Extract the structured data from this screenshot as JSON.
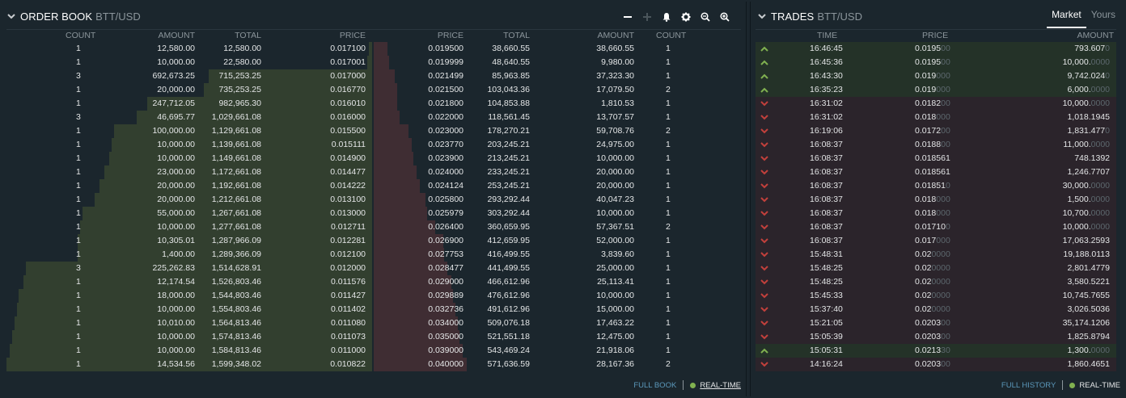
{
  "orderbook": {
    "title": "ORDER BOOK",
    "pair": "BTT/USD",
    "toolbar": [
      "minus-icon",
      "plus-icon",
      "bell-icon",
      "gear-icon",
      "zoom-out-icon",
      "zoom-in-icon"
    ],
    "bid_headers": {
      "count": "COUNT",
      "amount": "AMOUNT",
      "total": "TOTAL",
      "price": "PRICE"
    },
    "ask_headers": {
      "price": "PRICE",
      "total": "TOTAL",
      "amount": "AMOUNT",
      "count": "COUNT"
    },
    "max_total": 1599348.02,
    "ask_max_total": 571636.59,
    "bids": [
      {
        "count": "1",
        "amount": "12,580.00",
        "total": "12,580.00",
        "price": "0.017100",
        "total_value": 12580.0
      },
      {
        "count": "1",
        "amount": "10,000.00",
        "total": "22,580.00",
        "price": "0.017001",
        "total_value": 22580.0
      },
      {
        "count": "3",
        "amount": "692,673.25",
        "total": "715,253.25",
        "price": "0.017000",
        "total_value": 715253.25
      },
      {
        "count": "1",
        "amount": "20,000.00",
        "total": "735,253.25",
        "price": "0.016770",
        "total_value": 735253.25
      },
      {
        "count": "1",
        "amount": "247,712.05",
        "total": "982,965.30",
        "price": "0.016010",
        "total_value": 982965.3
      },
      {
        "count": "3",
        "amount": "46,695.77",
        "total": "1,029,661.08",
        "price": "0.016000",
        "total_value": 1029661.08
      },
      {
        "count": "1",
        "amount": "100,000.00",
        "total": "1,129,661.08",
        "price": "0.015500",
        "total_value": 1129661.08
      },
      {
        "count": "1",
        "amount": "10,000.00",
        "total": "1,139,661.08",
        "price": "0.015111",
        "total_value": 1139661.08
      },
      {
        "count": "1",
        "amount": "10,000.00",
        "total": "1,149,661.08",
        "price": "0.014900",
        "total_value": 1149661.08
      },
      {
        "count": "1",
        "amount": "23,000.00",
        "total": "1,172,661.08",
        "price": "0.014477",
        "total_value": 1172661.08
      },
      {
        "count": "1",
        "amount": "20,000.00",
        "total": "1,192,661.08",
        "price": "0.014222",
        "total_value": 1192661.08
      },
      {
        "count": "1",
        "amount": "20,000.00",
        "total": "1,212,661.08",
        "price": "0.013100",
        "total_value": 1212661.08
      },
      {
        "count": "1",
        "amount": "55,000.00",
        "total": "1,267,661.08",
        "price": "0.013000",
        "total_value": 1267661.08
      },
      {
        "count": "1",
        "amount": "10,000.00",
        "total": "1,277,661.08",
        "price": "0.012711",
        "total_value": 1277661.08
      },
      {
        "count": "1",
        "amount": "10,305.01",
        "total": "1,287,966.09",
        "price": "0.012281",
        "total_value": 1287966.09
      },
      {
        "count": "1",
        "amount": "1,400.00",
        "total": "1,289,366.09",
        "price": "0.012100",
        "total_value": 1289366.09
      },
      {
        "count": "3",
        "amount": "225,262.83",
        "total": "1,514,628.91",
        "price": "0.012000",
        "total_value": 1514628.91
      },
      {
        "count": "1",
        "amount": "12,174.54",
        "total": "1,526,803.46",
        "price": "0.011576",
        "total_value": 1526803.46
      },
      {
        "count": "1",
        "amount": "18,000.00",
        "total": "1,544,803.46",
        "price": "0.011427",
        "total_value": 1544803.46
      },
      {
        "count": "1",
        "amount": "10,000.00",
        "total": "1,554,803.46",
        "price": "0.011402",
        "total_value": 1554803.46
      },
      {
        "count": "1",
        "amount": "10,010.00",
        "total": "1,564,813.46",
        "price": "0.011080",
        "total_value": 1564813.46
      },
      {
        "count": "1",
        "amount": "10,000.00",
        "total": "1,574,813.46",
        "price": "0.011073",
        "total_value": 1574813.46
      },
      {
        "count": "1",
        "amount": "10,000.00",
        "total": "1,584,813.46",
        "price": "0.011000",
        "total_value": 1584813.46
      },
      {
        "count": "1",
        "amount": "14,534.56",
        "total": "1,599,348.02",
        "price": "0.010822",
        "total_value": 1599348.02
      }
    ],
    "asks": [
      {
        "price": "0.019500",
        "total": "38,660.55",
        "amount": "38,660.55",
        "count": "1",
        "total_value": 38660.55
      },
      {
        "price": "0.019999",
        "total": "48,640.55",
        "amount": "9,980.00",
        "count": "1",
        "total_value": 48640.55
      },
      {
        "price": "0.021499",
        "total": "85,963.85",
        "amount": "37,323.30",
        "count": "1",
        "total_value": 85963.85
      },
      {
        "price": "0.021500",
        "total": "103,043.36",
        "amount": "17,079.50",
        "count": "2",
        "total_value": 103043.36
      },
      {
        "price": "0.021800",
        "total": "104,853.88",
        "amount": "1,810.53",
        "count": "1",
        "total_value": 104853.88
      },
      {
        "price": "0.022000",
        "total": "118,561.45",
        "amount": "13,707.57",
        "count": "1",
        "total_value": 118561.45
      },
      {
        "price": "0.023000",
        "total": "178,270.21",
        "amount": "59,708.76",
        "count": "2",
        "total_value": 178270.21
      },
      {
        "price": "0.023770",
        "total": "203,245.21",
        "amount": "24,975.00",
        "count": "1",
        "total_value": 203245.21
      },
      {
        "price": "0.023900",
        "total": "213,245.21",
        "amount": "10,000.00",
        "count": "1",
        "total_value": 213245.21
      },
      {
        "price": "0.024000",
        "total": "233,245.21",
        "amount": "20,000.00",
        "count": "1",
        "total_value": 233245.21
      },
      {
        "price": "0.024124",
        "total": "253,245.21",
        "amount": "20,000.00",
        "count": "1",
        "total_value": 253245.21
      },
      {
        "price": "0.025800",
        "total": "293,292.44",
        "amount": "40,047.23",
        "count": "1",
        "total_value": 293292.44
      },
      {
        "price": "0.025979",
        "total": "303,292.44",
        "amount": "10,000.00",
        "count": "1",
        "total_value": 303292.44
      },
      {
        "price": "0.026400",
        "total": "360,659.95",
        "amount": "57,367.51",
        "count": "2",
        "total_value": 360659.95
      },
      {
        "price": "0.026900",
        "total": "412,659.95",
        "amount": "52,000.00",
        "count": "1",
        "total_value": 412659.95
      },
      {
        "price": "0.027753",
        "total": "416,499.55",
        "amount": "3,839.60",
        "count": "1",
        "total_value": 416499.55
      },
      {
        "price": "0.028477",
        "total": "441,499.55",
        "amount": "25,000.00",
        "count": "1",
        "total_value": 441499.55
      },
      {
        "price": "0.029000",
        "total": "466,612.96",
        "amount": "25,113.41",
        "count": "1",
        "total_value": 466612.96
      },
      {
        "price": "0.029889",
        "total": "476,612.96",
        "amount": "10,000.00",
        "count": "1",
        "total_value": 476612.96
      },
      {
        "price": "0.032736",
        "total": "491,612.96",
        "amount": "15,000.00",
        "count": "1",
        "total_value": 491612.96
      },
      {
        "price": "0.034000",
        "total": "509,076.18",
        "amount": "17,463.22",
        "count": "1",
        "total_value": 509076.18
      },
      {
        "price": "0.035000",
        "total": "521,551.18",
        "amount": "12,475.00",
        "count": "1",
        "total_value": 521551.18
      },
      {
        "price": "0.039000",
        "total": "543,469.24",
        "amount": "21,918.06",
        "count": "1",
        "total_value": 543469.24
      },
      {
        "price": "0.040000",
        "total": "571,636.59",
        "amount": "28,167.36",
        "count": "2",
        "total_value": 571636.59
      }
    ],
    "footer": {
      "full_book": "FULL BOOK",
      "realtime": "REAL-TIME"
    }
  },
  "trades": {
    "title": "TRADES",
    "pair": "BTT/USD",
    "tabs": [
      {
        "label": "Market",
        "active": true
      },
      {
        "label": "Yours",
        "active": false
      }
    ],
    "headers": {
      "time": "TIME",
      "price": "PRICE",
      "amount": "AMOUNT"
    },
    "rows": [
      {
        "side": "buy",
        "time": "16:46:45",
        "price": "0.0195",
        "price_dim": "00",
        "amount": "793.607",
        "amount_dim": "0"
      },
      {
        "side": "buy",
        "time": "16:45:36",
        "price": "0.0195",
        "price_dim": "00",
        "amount": "10,000.",
        "amount_dim": "0000"
      },
      {
        "side": "buy",
        "time": "16:43:30",
        "price": "0.019",
        "price_dim": "000",
        "amount": "9,742.024",
        "amount_dim": "0"
      },
      {
        "side": "buy",
        "time": "16:35:23",
        "price": "0.019",
        "price_dim": "000",
        "amount": "6,000.",
        "amount_dim": "0000"
      },
      {
        "side": "sell",
        "time": "16:31:02",
        "price": "0.0182",
        "price_dim": "00",
        "amount": "10,000.",
        "amount_dim": "0000"
      },
      {
        "side": "sell",
        "time": "16:31:02",
        "price": "0.018",
        "price_dim": "000",
        "amount": "1,018.1945",
        "amount_dim": ""
      },
      {
        "side": "sell",
        "time": "16:19:06",
        "price": "0.0172",
        "price_dim": "00",
        "amount": "1,831.477",
        "amount_dim": "0"
      },
      {
        "side": "sell",
        "time": "16:08:37",
        "price": "0.0188",
        "price_dim": "00",
        "amount": "11,000.",
        "amount_dim": "0000"
      },
      {
        "side": "sell",
        "time": "16:08:37",
        "price": "0.018561",
        "price_dim": "",
        "amount": "748.1392",
        "amount_dim": ""
      },
      {
        "side": "sell",
        "time": "16:08:37",
        "price": "0.018561",
        "price_dim": "",
        "amount": "1,246.7707",
        "amount_dim": ""
      },
      {
        "side": "sell",
        "time": "16:08:37",
        "price": "0.01851",
        "price_dim": "0",
        "amount": "30,000.",
        "amount_dim": "0000"
      },
      {
        "side": "sell",
        "time": "16:08:37",
        "price": "0.018",
        "price_dim": "000",
        "amount": "1,500.",
        "amount_dim": "0000"
      },
      {
        "side": "sell",
        "time": "16:08:37",
        "price": "0.018",
        "price_dim": "000",
        "amount": "10,700.",
        "amount_dim": "0000"
      },
      {
        "side": "sell",
        "time": "16:08:37",
        "price": "0.01710",
        "price_dim": "0",
        "amount": "10,000.",
        "amount_dim": "0000"
      },
      {
        "side": "sell",
        "time": "16:08:37",
        "price": "0.017",
        "price_dim": "000",
        "amount": "17,063.2593",
        "amount_dim": ""
      },
      {
        "side": "sell",
        "time": "15:48:31",
        "price": "0.02",
        "price_dim": "0000",
        "amount": "19,188.0113",
        "amount_dim": ""
      },
      {
        "side": "sell",
        "time": "15:48:25",
        "price": "0.02",
        "price_dim": "0000",
        "amount": "2,801.4779",
        "amount_dim": ""
      },
      {
        "side": "sell",
        "time": "15:48:25",
        "price": "0.02",
        "price_dim": "0000",
        "amount": "3,580.5221",
        "amount_dim": ""
      },
      {
        "side": "sell",
        "time": "15:45:33",
        "price": "0.02",
        "price_dim": "0000",
        "amount": "10,745.7655",
        "amount_dim": ""
      },
      {
        "side": "sell",
        "time": "15:37:40",
        "price": "0.02",
        "price_dim": "0000",
        "amount": "3,026.5036",
        "amount_dim": ""
      },
      {
        "side": "sell",
        "time": "15:21:05",
        "price": "0.0203",
        "price_dim": "00",
        "amount": "35,174.1206",
        "amount_dim": ""
      },
      {
        "side": "sell",
        "time": "15:05:39",
        "price": "0.0203",
        "price_dim": "00",
        "amount": "1,825.8794",
        "amount_dim": ""
      },
      {
        "side": "buy",
        "time": "15:05:31",
        "price": "0.0213",
        "price_dim": "30",
        "amount": "1,300.",
        "amount_dim": "0000"
      },
      {
        "side": "sell",
        "time": "14:16:24",
        "price": "0.0203",
        "price_dim": "00",
        "amount": "1,860.4651",
        "amount_dim": ""
      }
    ],
    "footer": {
      "full_history": "FULL HISTORY",
      "realtime": "REAL-TIME"
    }
  },
  "colors": {
    "buy": "#80b150",
    "sell": "#c2403c",
    "bid_bar": "#323f2f",
    "ask_bar": "#3f2d33",
    "link": "#5b98bb"
  }
}
